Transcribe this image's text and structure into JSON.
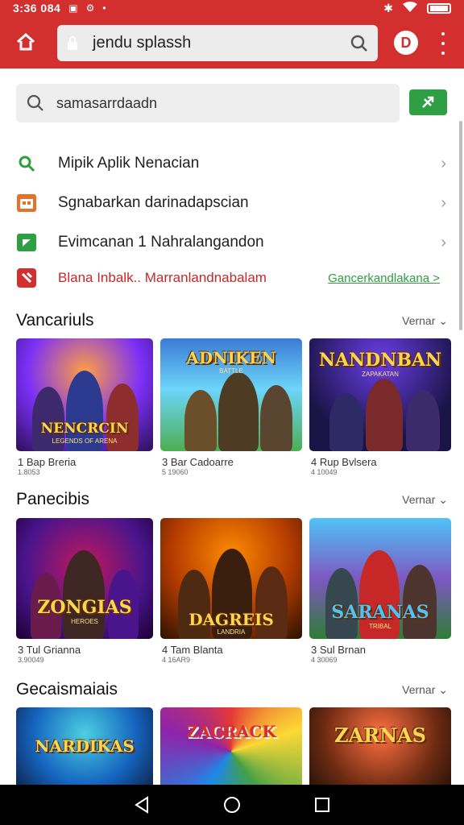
{
  "status_bar": {
    "time": "3:36 084",
    "icons_left": [
      "square-icon",
      "gear-icon",
      "notification-icon"
    ],
    "icons_right": [
      "bluetooth-icon",
      "wifi-icon",
      "battery-icon"
    ]
  },
  "browser": {
    "url": "jendu splassh",
    "profile_letter": "D",
    "accent": "#d32f2f"
  },
  "search": {
    "placeholder": "samasarrdaadn"
  },
  "menu": [
    {
      "label": "Mipik Aplik  Nenacian",
      "icon": "search-icon",
      "color": "#2e9e3e"
    },
    {
      "label": "Sgnabarkan darinadapscian",
      "icon": "calendar-icon",
      "color": "#e8712a"
    },
    {
      "label": "Evimcanan 1 Nahralangandon",
      "icon": "chat-icon",
      "color": "#2ea043"
    }
  ],
  "alert": {
    "label": "Blana Inbalk.. Marranlandnabalam",
    "link": "Gancerkandlakana >"
  },
  "sections": [
    {
      "title": "Vancariuls",
      "more": "Vernar",
      "cards": [
        {
          "title": "NENCRCIN",
          "sub": "LEGENDS OF ARENA",
          "meta1": "1  Bap Breria",
          "meta2": "1.8053"
        },
        {
          "title": "ADNIKEN",
          "sub": "BATTLE",
          "meta1": "3  Bar Cadoarre",
          "meta2": "5 19060"
        },
        {
          "title": "NANDNBAN",
          "sub": "ZAPAKATAN",
          "meta1": "4  Rup Bvlsera",
          "meta2": "4 10049"
        }
      ]
    },
    {
      "title": "Panecibis",
      "more": "Vernar",
      "cards": [
        {
          "title": "ZONGIAS",
          "sub": "HEROES",
          "meta1": "3  Tul Grianna",
          "meta2": "3.90049"
        },
        {
          "title": "DAGREIS",
          "sub": "LANDRIA",
          "meta1": "4  Tam Blanta",
          "meta2": "4 16AR9"
        },
        {
          "title": "SARANAS",
          "sub": "TRIBAL",
          "meta1": "3  Sul Brnan",
          "meta2": "4 30069"
        }
      ]
    },
    {
      "title": "Gecaismaiais",
      "more": "Vernar",
      "cards": [
        {
          "title": "NARDIKAS",
          "sub": "",
          "meta1": "",
          "meta2": ""
        },
        {
          "title": "ZACRACK",
          "sub": "",
          "meta1": "",
          "meta2": ""
        },
        {
          "title": "ZARNAS",
          "sub": "",
          "meta1": "",
          "meta2": ""
        }
      ]
    }
  ]
}
